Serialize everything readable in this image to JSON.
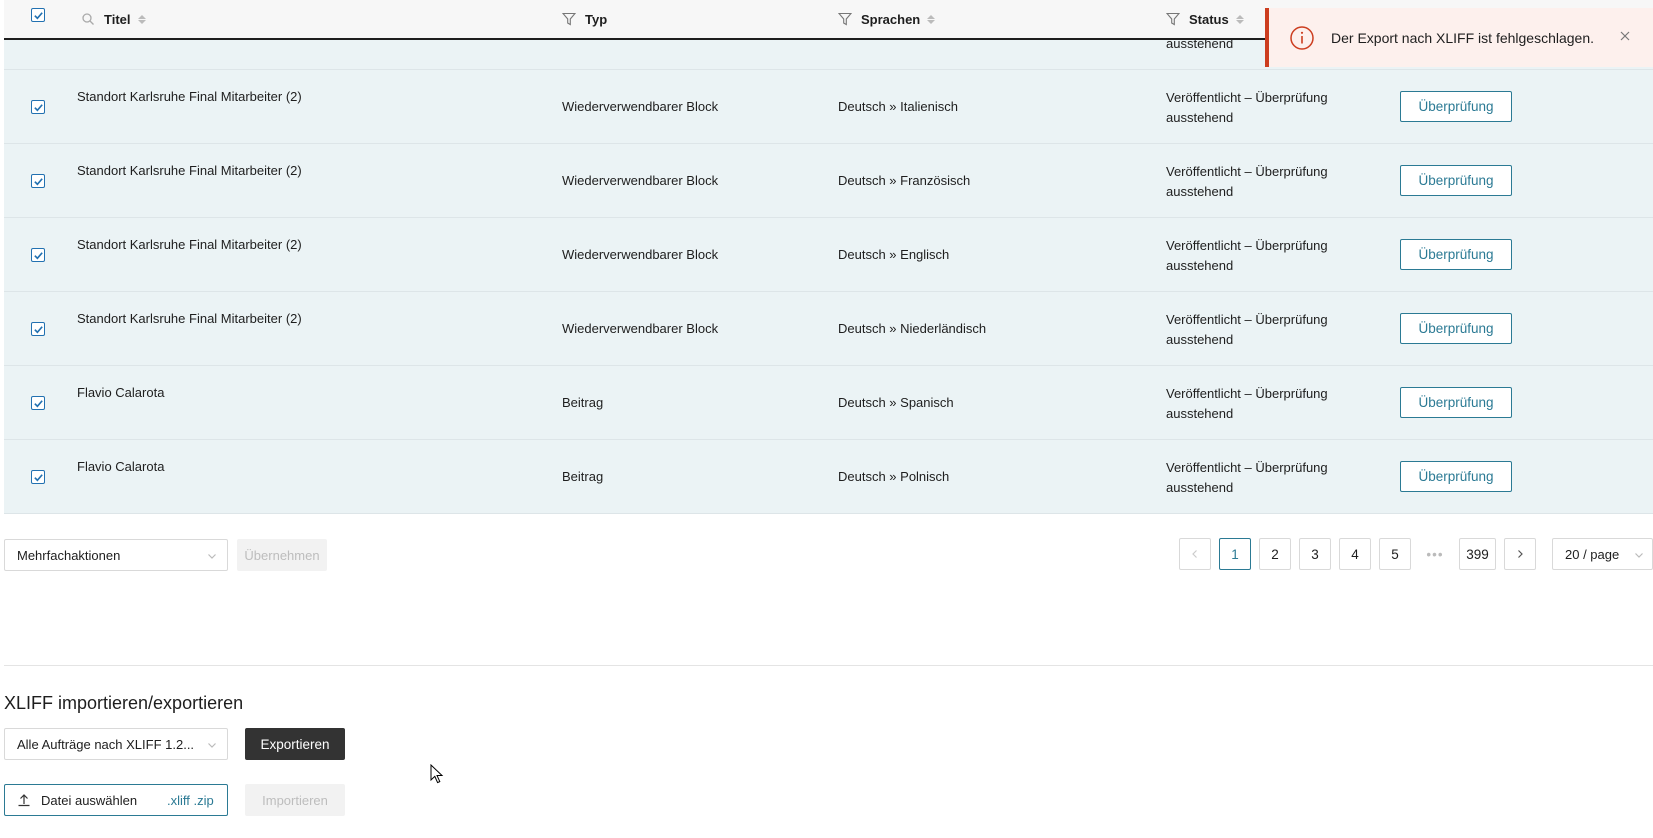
{
  "table": {
    "headers": {
      "title": "Titel",
      "type": "Typ",
      "languages": "Sprachen",
      "status": "Status"
    },
    "partial_row_status": "ausstehend",
    "rows": [
      {
        "title": "Standort Karlsruhe Final Mitarbeiter (2)",
        "type": "Wiederverwendbarer Block",
        "languages": "Deutsch » Italienisch",
        "status_line1": "Veröffentlicht – Überprüfung",
        "status_line2": "ausstehend",
        "action": "Überprüfung"
      },
      {
        "title": "Standort Karlsruhe Final Mitarbeiter (2)",
        "type": "Wiederverwendbarer Block",
        "languages": "Deutsch » Französisch",
        "status_line1": "Veröffentlicht – Überprüfung",
        "status_line2": "ausstehend",
        "action": "Überprüfung"
      },
      {
        "title": "Standort Karlsruhe Final Mitarbeiter (2)",
        "type": "Wiederverwendbarer Block",
        "languages": "Deutsch » Englisch",
        "status_line1": "Veröffentlicht – Überprüfung",
        "status_line2": "ausstehend",
        "action": "Überprüfung"
      },
      {
        "title": "Standort Karlsruhe Final Mitarbeiter (2)",
        "type": "Wiederverwendbarer Block",
        "languages": "Deutsch » Niederländisch",
        "status_line1": "Veröffentlicht – Überprüfung",
        "status_line2": "ausstehend",
        "action": "Überprüfung"
      },
      {
        "title": "Flavio Calarota",
        "type": "Beitrag",
        "languages": "Deutsch » Spanisch",
        "status_line1": "Veröffentlicht – Überprüfung",
        "status_line2": "ausstehend",
        "action": "Überprüfung"
      },
      {
        "title": "Flavio Calarota",
        "type": "Beitrag",
        "languages": "Deutsch » Polnisch",
        "status_line1": "Veröffentlicht – Überprüfung",
        "status_line2": "ausstehend",
        "action": "Überprüfung"
      }
    ]
  },
  "bulk": {
    "select_label": "Mehrfachaktionen",
    "apply_label": "Übernehmen"
  },
  "pagination": {
    "pages": [
      "1",
      "2",
      "3",
      "4",
      "5"
    ],
    "ellipsis": "•••",
    "last_page": "399",
    "current": "1",
    "per_page": "20 / page"
  },
  "xliff": {
    "heading": "XLIFF importieren/exportieren",
    "export_select": "Alle Aufträge nach XLIFF 1.2...",
    "export_button": "Exportieren",
    "file_button": "Datei auswählen",
    "file_ext": ".xliff .zip",
    "import_button": "Importieren"
  },
  "toast": {
    "message": "Der Export nach XLIFF ist fehlgeschlagen."
  },
  "colors": {
    "accent": "#2b7a94",
    "checkbox": "#2271b1",
    "row_bg": "#ebf3f5",
    "toast_border": "#cc3d1f",
    "toast_bg": "#fdf0ed"
  }
}
